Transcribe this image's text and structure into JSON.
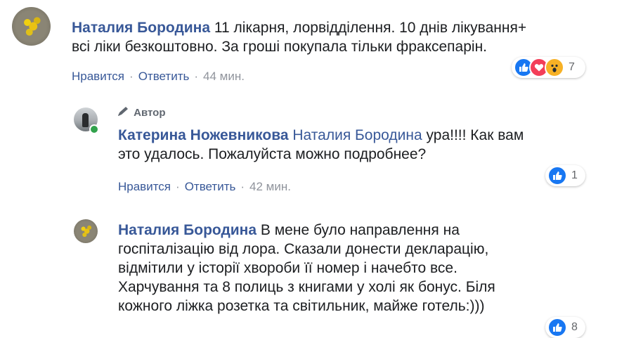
{
  "comments": [
    {
      "author": "Наталия Бородина",
      "text_line1": "11 лікарня, лорвідділення. 10 днів лікування+",
      "text_line2": "всі ліки безкоштовно. За гроші покупала тільки фраксепарін.",
      "like_label": "Нравится",
      "reply_label": "Ответить",
      "time": "44 мин.",
      "reaction_count": "7",
      "reactions": [
        "like-icon",
        "love-icon",
        "wow-icon"
      ]
    },
    {
      "author_badge": "Автор",
      "author": "Катерина Ножевникова",
      "mention": "Наталия Бородина",
      "text_line1_rest": "ура!!!! Как вам",
      "text_line2": "это удалось. Пожалуйста можно подробнее?",
      "like_label": "Нравится",
      "reply_label": "Ответить",
      "time": "42 мин.",
      "reaction_count": "1",
      "reactions": [
        "like-icon"
      ]
    },
    {
      "author": "Наталия Бородина",
      "text_line1_rest": "В мене було направлення на",
      "text_line2": "госпіталізацію від лора. Сказали донести декларацію,",
      "text_line3": "відмітили у історії хвороби її номер і начебто все.",
      "text_line4": "Харчування та 8 полиць з книгами у холі як бонус. Біля",
      "text_line5": "кожного ліжка розетка та світильник, майже готель:)))",
      "reaction_count": "8"
    }
  ],
  "actions": {
    "separator": "·"
  }
}
